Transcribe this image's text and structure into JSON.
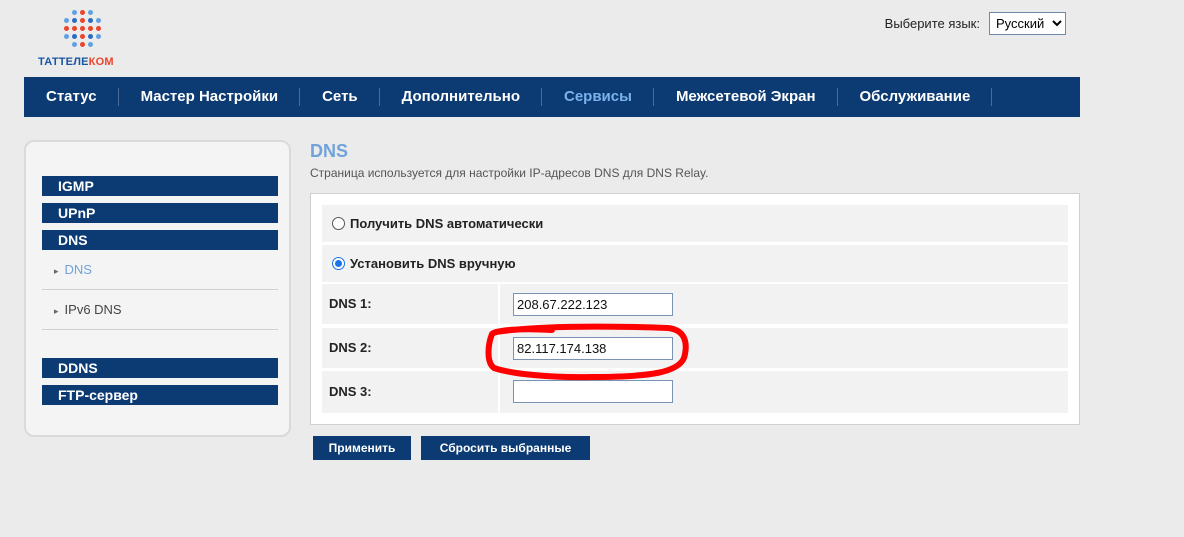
{
  "logo": {
    "text_part1": "ТАТТЕЛЕ",
    "text_part2": "КОМ"
  },
  "language": {
    "label": "Выберите язык:",
    "selected": "Русский"
  },
  "topnav": {
    "items": [
      {
        "label": "Статус"
      },
      {
        "label": "Мастер Настройки"
      },
      {
        "label": "Сеть"
      },
      {
        "label": "Дополнительно"
      },
      {
        "label": "Сервисы",
        "active": true
      },
      {
        "label": "Межсетевой Экран"
      },
      {
        "label": "Обслуживание"
      }
    ]
  },
  "sidebar": {
    "igmp": "IGMP",
    "upnp": "UPnP",
    "dns": "DNS",
    "dns_sub": "DNS",
    "ipv6dns_sub": "IPv6 DNS",
    "ddns": "DDNS",
    "ftp": "FTP-сервер"
  },
  "main": {
    "title": "DNS",
    "description": "Страница используется для настройки IP-адресов DNS для DNS Relay.",
    "radio_auto": "Получить DNS автоматически",
    "radio_manual": "Установить DNS вручную",
    "dns1_label": "DNS 1:",
    "dns1_value": "208.67.222.123",
    "dns2_label": "DNS 2:",
    "dns2_value": "82.117.174.138",
    "dns3_label": "DNS 3:",
    "dns3_value": ""
  },
  "buttons": {
    "apply": "Применить",
    "reset": "Сбросить выбранные"
  },
  "colors": {
    "nav_bg": "#0c3b74",
    "accent": "#6fa3da",
    "annotation": "#ff0000"
  }
}
